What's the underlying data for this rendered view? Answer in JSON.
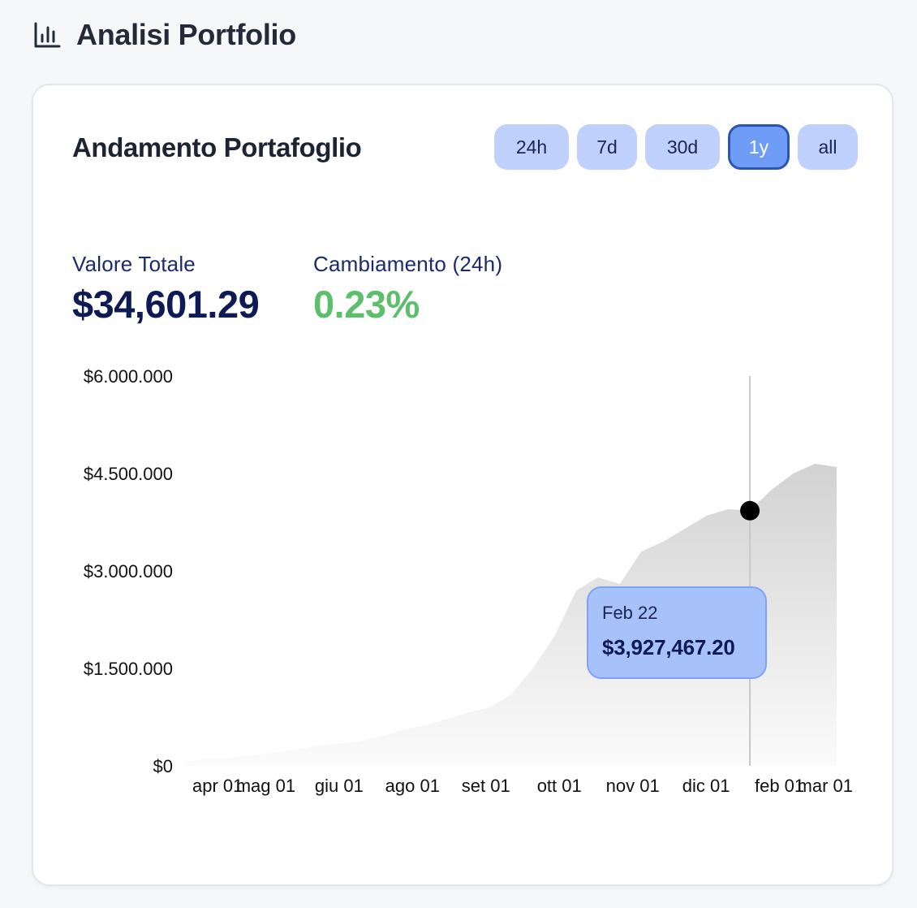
{
  "header": {
    "title": "Analisi Portfolio",
    "icon": "bar-chart-icon"
  },
  "card": {
    "title": "Andamento Portafoglio",
    "ranges": [
      {
        "label": "24h",
        "active": false
      },
      {
        "label": "7d",
        "active": false
      },
      {
        "label": "30d",
        "active": false
      },
      {
        "label": "1y",
        "active": true
      },
      {
        "label": "all",
        "active": false
      }
    ]
  },
  "stats": {
    "total_label": "Valore Totale",
    "total_value": "$34,601.29",
    "change_label": "Cambiamento (24h)",
    "change_value": "0.23%"
  },
  "tooltip": {
    "date": "Feb 22",
    "value": "$3,927,467.20"
  },
  "colors": {
    "accent": "#6f9cf6",
    "button_bg": "#bed0fb",
    "positive": "#5dbf6c",
    "area_fill": "#d2d2d2",
    "marker": "#000000"
  },
  "chart_data": {
    "type": "area",
    "y_tick_labels": [
      "$6.000.000",
      "$4.500.000",
      "$3.000.000",
      "$1.500.000",
      "$0"
    ],
    "x_tick_labels": [
      "apr 01",
      "mag 01",
      "giu 01",
      "ago 01",
      "set 01",
      "ott 01",
      "nov 01",
      "dic 01",
      "feb 01",
      "mar 01"
    ],
    "ylim": [
      0,
      6000000
    ],
    "x": [
      "mar 15",
      "apr 01",
      "apr 15",
      "mag 01",
      "mag 15",
      "giu 01",
      "giu 15",
      "lug 01",
      "lug 15",
      "ago 01",
      "ago 15",
      "set 01",
      "set 15",
      "ott 01",
      "ott 15",
      "nov 01",
      "nov 10",
      "nov 20",
      "dic 01",
      "dic 10",
      "dic 20",
      "gen 01",
      "gen 10",
      "gen 20",
      "feb 01",
      "feb 10",
      "feb 22",
      "mar 01",
      "mar 05",
      "mar 10",
      "mar 13"
    ],
    "values": [
      80000,
      100000,
      130000,
      160000,
      200000,
      250000,
      300000,
      340000,
      380000,
      450000,
      560000,
      620000,
      720000,
      820000,
      900000,
      1100000,
      1500000,
      2000000,
      2700000,
      2900000,
      2800000,
      3300000,
      3450000,
      3650000,
      3850000,
      3950000,
      3927467,
      4250000,
      4500000,
      4650000,
      4600000
    ],
    "highlight": {
      "x": "feb 22",
      "value": 3927467.2
    },
    "grid": false,
    "legend": "none"
  }
}
